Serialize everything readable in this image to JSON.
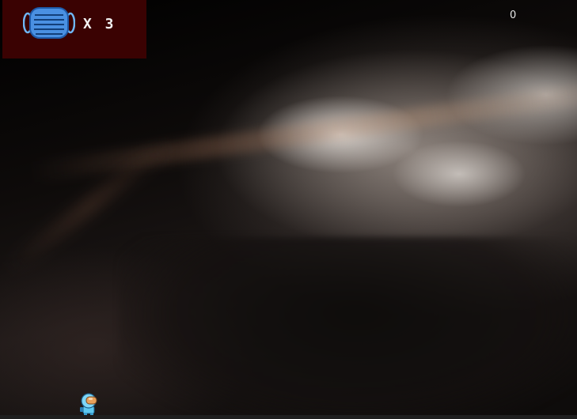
{
  "hud": {
    "lives_icon": "face-mask-icon",
    "lives_text": "X 3",
    "score": "0"
  },
  "colors": {
    "hud_panel": "#3a0202",
    "mask_fill": "#4a90e2",
    "mask_stroke": "#1e5aa8",
    "ground": "#1f1f1f",
    "player_suit": "#5ec8f0",
    "player_visor": "#e8a05a"
  },
  "scene": {
    "background": "nebula",
    "player": "astronaut-player"
  }
}
